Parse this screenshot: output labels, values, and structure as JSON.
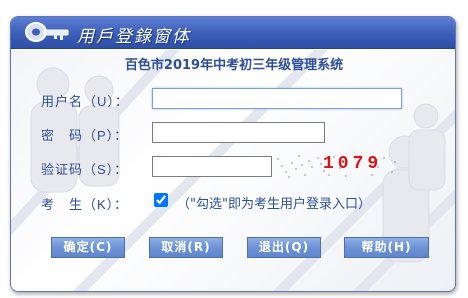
{
  "window": {
    "title": "用戶登錄窗体",
    "title_icon": "key-icon"
  },
  "form": {
    "system_name": "百色市2019年中考初三年级管理系统",
    "username": {
      "label": "用户名（U）：",
      "value": ""
    },
    "password": {
      "label": "密　码（P）：",
      "value": ""
    },
    "captcha": {
      "label": "验证码（S）：",
      "value": "",
      "code": "1079"
    },
    "examinee": {
      "label": "考　生（K）：",
      "checked": true,
      "note": "（\"勾选\"即为考生用户登录入口）"
    }
  },
  "buttons": {
    "ok": "确定(C)",
    "cancel": "取消(R)",
    "exit": "退出(Q)",
    "help": "帮助(H)"
  },
  "colors": {
    "title_bar": "#3b5eb8",
    "label": "#2f4f99",
    "captcha": "#d8141b",
    "button": "#6d93d6"
  }
}
